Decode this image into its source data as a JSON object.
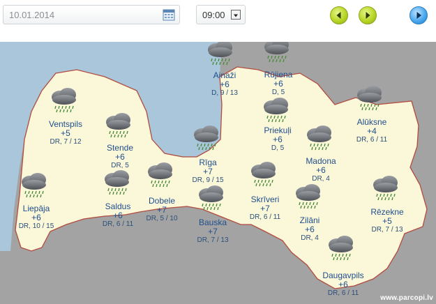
{
  "toolbar": {
    "date_value": "10.01.2014",
    "time_value": "09:00",
    "calendar_icon": "calendar-icon",
    "prev_icon": "arrow-left-icon",
    "next_icon": "arrow-right-icon",
    "play_icon": "play-icon",
    "accent_green": "#b8d626",
    "accent_blue": "#4ca9ee"
  },
  "map": {
    "land_color": "#fbf7d9",
    "sea_color": "#a9c6db",
    "neighbor_color": "#a3a3a3",
    "border_color": "#b24a3e",
    "cities": [
      {
        "name": "Ainaži",
        "temp": "+6",
        "wind": "D, 9 / 13",
        "icon": "rain-cloud-icon"
      },
      {
        "name": "Rūjiena",
        "temp": "+6",
        "wind": "D, 5",
        "icon": "rain-cloud-icon"
      },
      {
        "name": "Ventspils",
        "temp": "+5",
        "wind": "DR, 7 / 12",
        "icon": "rain-cloud-icon"
      },
      {
        "name": "Stende",
        "temp": "+6",
        "wind": "DR, 5",
        "icon": "rain-cloud-icon"
      },
      {
        "name": "Priekuļi",
        "temp": "+6",
        "wind": "D, 5",
        "icon": "rain-cloud-icon"
      },
      {
        "name": "Alūksne",
        "temp": "+4",
        "wind": "DR, 6 / 11",
        "icon": "rain-cloud-icon"
      },
      {
        "name": "Rīga",
        "temp": "+7",
        "wind": "DR, 9 / 15",
        "icon": "rain-cloud-icon"
      },
      {
        "name": "Madona",
        "temp": "+6",
        "wind": "DR, 4",
        "icon": "rain-cloud-icon"
      },
      {
        "name": "Liepāja",
        "temp": "+6",
        "wind": "DR, 10 / 15",
        "icon": "rain-cloud-icon"
      },
      {
        "name": "Saldus",
        "temp": "+6",
        "wind": "DR, 6 / 11",
        "icon": "rain-cloud-icon"
      },
      {
        "name": "Dobele",
        "temp": "+7",
        "wind": "DR, 5 / 10",
        "icon": "rain-cloud-icon"
      },
      {
        "name": "Skrīveri",
        "temp": "+7",
        "wind": "DR, 6 / 11",
        "icon": "rain-cloud-icon"
      },
      {
        "name": "Rēzekne",
        "temp": "+5",
        "wind": "DR, 7 / 13",
        "icon": "rain-cloud-icon"
      },
      {
        "name": "Zilāni",
        "temp": "+6",
        "wind": "DR, 4",
        "icon": "rain-cloud-icon"
      },
      {
        "name": "Bauska",
        "temp": "+7",
        "wind": "DR, 7 / 13",
        "icon": "rain-cloud-icon"
      },
      {
        "name": "Daugavpils",
        "temp": "+6",
        "wind": "DR, 6 / 11",
        "icon": "rain-cloud-icon"
      }
    ]
  },
  "watermark": "www.parcopi.lv"
}
